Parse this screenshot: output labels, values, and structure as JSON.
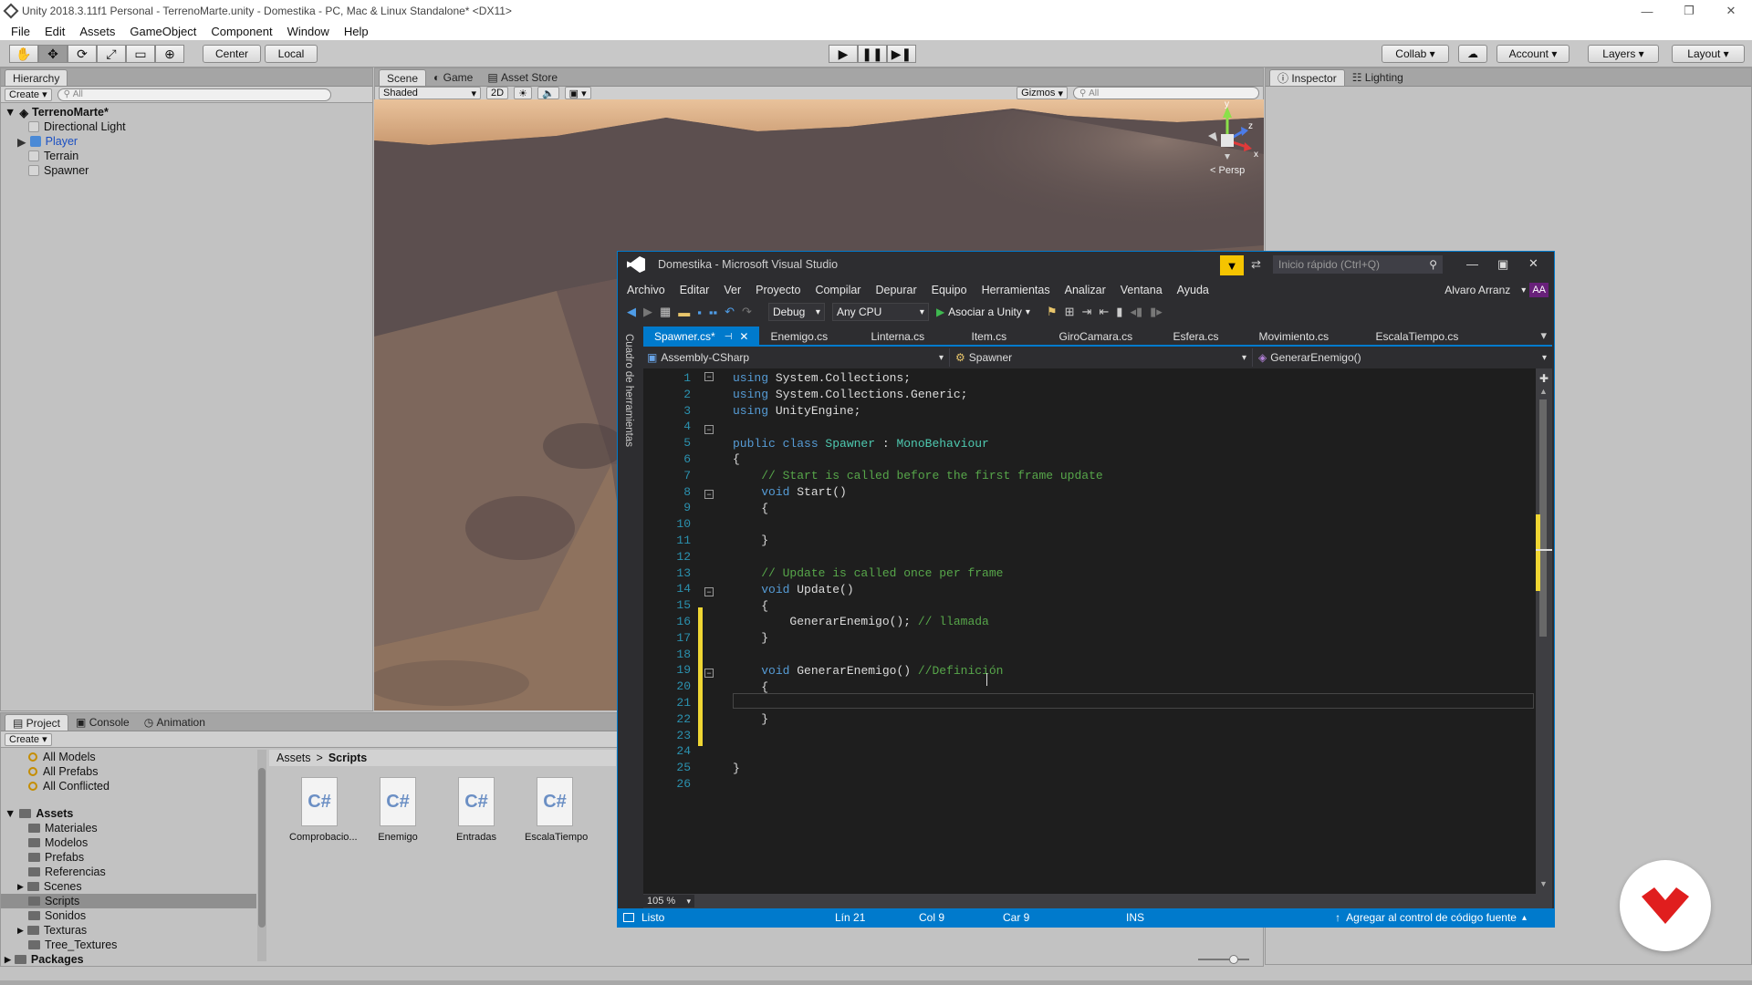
{
  "unity": {
    "window_title": "Unity 2018.3.11f1 Personal - TerrenoMarte.unity - Domestika - PC, Mac & Linux Standalone* <DX11>",
    "menu": [
      "File",
      "Edit",
      "Assets",
      "GameObject",
      "Component",
      "Window",
      "Help"
    ],
    "toolbar": {
      "center": "Center",
      "local": "Local",
      "collab": "Collab",
      "account": "Account",
      "layers": "Layers",
      "layout": "Layout"
    },
    "hierarchy": {
      "tab": "Hierarchy",
      "create": "Create",
      "search_placeholder": "All",
      "scene_name": "TerrenoMarte*",
      "items": [
        "Directional Light",
        "Player",
        "Terrain",
        "Spawner"
      ]
    },
    "scene": {
      "tabs": [
        "Scene",
        "Game",
        "Asset Store"
      ],
      "shading": "Shaded",
      "mode_2d": "2D",
      "gizmos": "Gizmos",
      "search_placeholder": "All",
      "persp": "Persp",
      "axis_y": "y",
      "axis_z": "z",
      "axis_x": "x"
    },
    "inspector": {
      "tabs": [
        "Inspector",
        "Lighting"
      ]
    },
    "project": {
      "tabs": [
        "Project",
        "Console",
        "Animation"
      ],
      "create": "Create",
      "favorites": [
        "All Models",
        "All Prefabs",
        "All Conflicted"
      ],
      "assets_root": "Assets",
      "folders": [
        "Materiales",
        "Modelos",
        "Prefabs",
        "Referencias",
        "Scenes",
        "Scripts",
        "Sonidos",
        "Texturas",
        "Tree_Textures"
      ],
      "packages": "Packages",
      "breadcrumb": [
        "Assets",
        "Scripts"
      ],
      "files": [
        "Comprobacio...",
        "Enemigo",
        "Entradas",
        "EscalaTiempo"
      ],
      "file_icon_text": "C#"
    }
  },
  "vs": {
    "title": "Domestika - Microsoft Visual Studio",
    "quick_launch": "Inicio rápido (Ctrl+Q)",
    "menu": [
      "Archivo",
      "Editar",
      "Ver",
      "Proyecto",
      "Compilar",
      "Depurar",
      "Equipo",
      "Herramientas",
      "Analizar",
      "Ventana",
      "Ayuda"
    ],
    "user": "Alvaro Arranz",
    "user_initials": "AA",
    "config": "Debug",
    "platform": "Any CPU",
    "attach": "Asociar a Unity",
    "side_toolbox": "Cuadro de herramientas",
    "tabs": [
      "Spawner.cs*",
      "Enemigo.cs",
      "Linterna.cs",
      "Item.cs",
      "GiroCamara.cs",
      "Esfera.cs",
      "Movimiento.cs",
      "EscalaTiempo.cs"
    ],
    "nav": {
      "project": "Assembly-CSharp",
      "class": "Spawner",
      "member": "GenerarEnemigo()"
    },
    "code": [
      [
        [
          "kw",
          "using "
        ],
        [
          "pl",
          "System.Collections;"
        ]
      ],
      [
        [
          "kw",
          "using "
        ],
        [
          "pl",
          "System.Collections.Generic;"
        ]
      ],
      [
        [
          "kw",
          "using "
        ],
        [
          "pl",
          "UnityEngine;"
        ]
      ],
      [],
      [
        [
          "kw",
          "public class "
        ],
        [
          "ty",
          "Spawner"
        ],
        [
          "pl",
          " : "
        ],
        [
          "ty",
          "MonoBehaviour"
        ]
      ],
      [
        [
          "pl",
          "{"
        ]
      ],
      [
        [
          "pl",
          "    "
        ],
        [
          "cm",
          "// Start is called before the first frame update"
        ]
      ],
      [
        [
          "pl",
          "    "
        ],
        [
          "kw",
          "void "
        ],
        [
          "pl",
          "Start()"
        ]
      ],
      [
        [
          "pl",
          "    {"
        ]
      ],
      [],
      [
        [
          "pl",
          "    }"
        ]
      ],
      [],
      [
        [
          "pl",
          "    "
        ],
        [
          "cm",
          "// Update is called once per frame"
        ]
      ],
      [
        [
          "pl",
          "    "
        ],
        [
          "kw",
          "void "
        ],
        [
          "pl",
          "Update()"
        ]
      ],
      [
        [
          "pl",
          "    {"
        ]
      ],
      [
        [
          "pl",
          "        GenerarEnemigo(); "
        ],
        [
          "cm",
          "// llamada"
        ]
      ],
      [
        [
          "pl",
          "    }"
        ]
      ],
      [],
      [
        [
          "pl",
          "    "
        ],
        [
          "kw",
          "void "
        ],
        [
          "pl",
          "GenerarEnemigo() "
        ],
        [
          "cm",
          "//Definición"
        ]
      ],
      [
        [
          "pl",
          "    {"
        ]
      ],
      [],
      [
        [
          "pl",
          "    }"
        ]
      ],
      [],
      [],
      [
        [
          "pl",
          "}"
        ]
      ],
      []
    ],
    "zoom": "105 %",
    "status": {
      "ready": "Listo",
      "line": "Lín 21",
      "col": "Col 9",
      "car": "Car 9",
      "ins": "INS",
      "source_control": "Agregar al control de código fuente"
    }
  },
  "colors": {
    "vs_accent": "#007acc",
    "vs_bg": "#1e1e1e",
    "keyword": "#569cd6",
    "type": "#4ec9b0",
    "comment": "#57a64a",
    "unity_panel": "#c2c2c2",
    "brand_red": "#e01e1e"
  }
}
